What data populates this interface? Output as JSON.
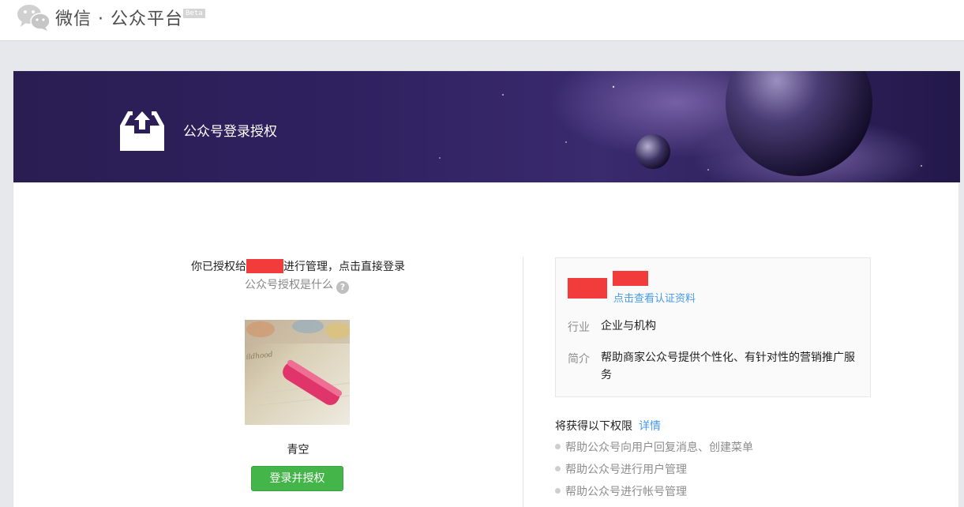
{
  "header": {
    "title": "微信 · 公众平台",
    "beta": "Beta",
    "logo_icon": "wechat-logo-icon"
  },
  "banner": {
    "title": "公众号登录授权",
    "icon": "upload-tray-icon"
  },
  "left": {
    "auth_prefix": "你已授权给",
    "auth_suffix": "进行管理，点击直接登录",
    "whatis": "公众号授权是什么",
    "help_icon": "?",
    "nickname": "青空",
    "login_button": "登录并授权"
  },
  "info": {
    "verify_link": "点击查看认证资料",
    "industry_label": "行业",
    "industry_value": "企业与机构",
    "intro_label": "简介",
    "intro_value": "帮助商家公众号提供个性化、有针对性的营销推广服务"
  },
  "permissions": {
    "title": "将获得以下权限",
    "detail_link": "详情",
    "items": [
      "帮助公众号向用户回复消息、创建菜单",
      "帮助公众号进行用户管理",
      "帮助公众号进行帐号管理"
    ]
  },
  "colors": {
    "accent_green": "#44b549",
    "link_blue": "#459ae9",
    "redaction": "#f23b3b",
    "banner_purple": "#2f2160"
  }
}
